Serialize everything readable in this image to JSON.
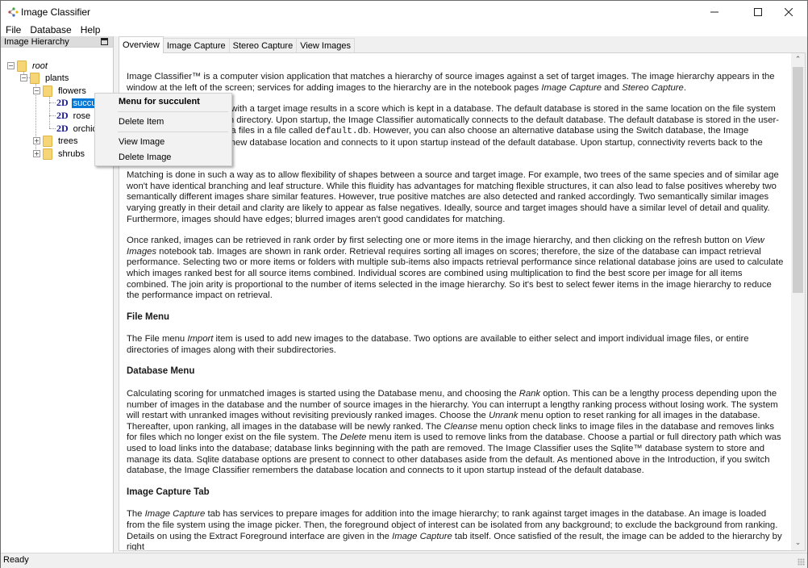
{
  "window": {
    "title": "Image Classifier",
    "controls": {
      "minimize": "—",
      "maximize": "☐",
      "close": "✕"
    }
  },
  "menubar": {
    "items": [
      "File",
      "Database",
      "Help"
    ]
  },
  "left_panel": {
    "title": "Image Hierarchy",
    "tree": [
      {
        "label": "root",
        "expander": "−",
        "type": "folder"
      },
      {
        "label": "plants",
        "expander": "−",
        "type": "folder"
      },
      {
        "label": "flowers",
        "expander": "−",
        "type": "folder"
      },
      {
        "label": "succulent",
        "tag": "2D",
        "type": "image",
        "selected": true
      },
      {
        "label": "rose",
        "tag": "2D",
        "type": "image"
      },
      {
        "label": "orchid",
        "tag": "2D",
        "type": "image"
      },
      {
        "label": "trees",
        "expander": "+",
        "type": "folder"
      },
      {
        "label": "shrubs",
        "expander": "+",
        "type": "folder"
      }
    ]
  },
  "context_menu": {
    "title": "Menu for succulent",
    "items": [
      "Delete Item",
      "View Image",
      "Delete Image"
    ]
  },
  "tabs": [
    {
      "label": "Overview",
      "active": true
    },
    {
      "label": "Image Capture"
    },
    {
      "label": "Stereo Capture"
    },
    {
      "label": "View Images"
    }
  ],
  "document": {
    "p1": {
      "a": "Image Classifier™ is a computer vision application that matches a hierarchy of source images against a set of target images. The image hierarchy appears in the window at the left of the screen; services for adding images to the hierarchy are in the notebook pages ",
      "i1": "Image Capture",
      "b": " and ",
      "i2": "Stereo Capture",
      "c": "."
    },
    "p2": {
      "a": "Matching a source image with a target image results in a score which is kept in a database. The default database is stored in the same location on the file system as the software installation directory. Upon startup, the Image Classifier automatically connects to the default database. The default database is stored in the user-dependent application data files in a file called ",
      "code": "default.db",
      "b": ". However, you can also choose an alternative database using the Switch database, the Image Classifier remembers the new database location and connects to it upon startup instead of the default database. Upon startup, connectivity reverts back to the default database."
    },
    "p3": "Matching is done in such a way as to allow flexibility of shapes between a source and target image. For example, two trees of the same species and of similar age won't have identical branching and leaf structure. While this fluidity has advantages for matching flexible structures, it can also lead to false positives whereby two semantically different images share similar features. However, true positive matches are also detected and ranked accordingly. Two semantically similar images varying greatly in their detail and clarity are likely to appear as false negatives. Ideally, source and target images should have a similar level of detail and quality. Furthermore, images should have edges; blurred images aren't good candidates for matching.",
    "p4": {
      "a": "Once ranked, images can be retrieved in rank order by first selecting one or more items in the image hierarchy, and then clicking on the refresh button on ",
      "i1": "View Images",
      "b": " notebook tab. Images are shown in rank order. Retrieval requires sorting all images on scores; therefore, the size of the database can impact retrieval performance. Selecting two or more items or folders with multiple sub-items also impacts retrieval performance since relational database joins are used to calculate which images ranked best for all source items combined. Individual scores are combined using multiplication to find the best score per image for all items combined. The join arity is proportional to the number of items selected in the image hierarchy. So it's best to select fewer items in the image hierarchy to reduce the performance impact on retrieval."
    },
    "h_file": "File Menu",
    "p5": {
      "a": "The File menu ",
      "i1": "Import",
      "b": " item is used to add new images to the database. Two options are available to either select and import individual image files, or entire directories of images along with their subdirectories."
    },
    "h_db": "Database Menu",
    "p6": {
      "a": "Calculating scoring for unmatched images is started using the Database menu, and choosing the ",
      "i1": "Rank",
      "b": " option. This can be a lengthy process depending upon the number of images in the database and the number of source images in the hierarchy. You can interrupt a lengthy ranking process without losing work. The system will restart with unranked images without revisiting previously ranked images. Choose the ",
      "i2": "Unrank",
      "c": " menu option to reset ranking for all images in the database. Thereafter, upon ranking, all images in the database will be newly ranked. The ",
      "i3": "Cleanse",
      "d": " menu option check links to image files in the database and removes links for files which no longer exist on the file system. The ",
      "i4": "Delete",
      "e": " menu item is used to remove links from the database. Choose a partial or full directory path which was used to load links into the database; database links beginning with the path are removed. The Image Classifier uses the Sqlite™ database system to store and manage its data. Sqlite database options are present to connect to other databases aside from the default. As mentioned above in the Introduction, if you switch database, the Image Classifier remembers the database location and connects to it upon startup instead of the default database."
    },
    "h_capture": "Image Capture Tab",
    "p7": {
      "a": "The ",
      "i1": "Image Capture",
      "b": " tab has services to prepare images for addition into the image hierarchy; to rank against target images in the database. An image is loaded from the file system using the image picker. Then, the foreground object of interest can be isolated from any background; to exclude the background from ranking. Details on using the Extract Foreground interface are given in the ",
      "i2": "Image Capture",
      "c": " tab itself. Once satisfied of the result, the image can be added to the hierarchy by right"
    }
  },
  "scrollbar": {
    "up": "⌃",
    "down": "⌄"
  },
  "status": {
    "text": "Ready"
  }
}
